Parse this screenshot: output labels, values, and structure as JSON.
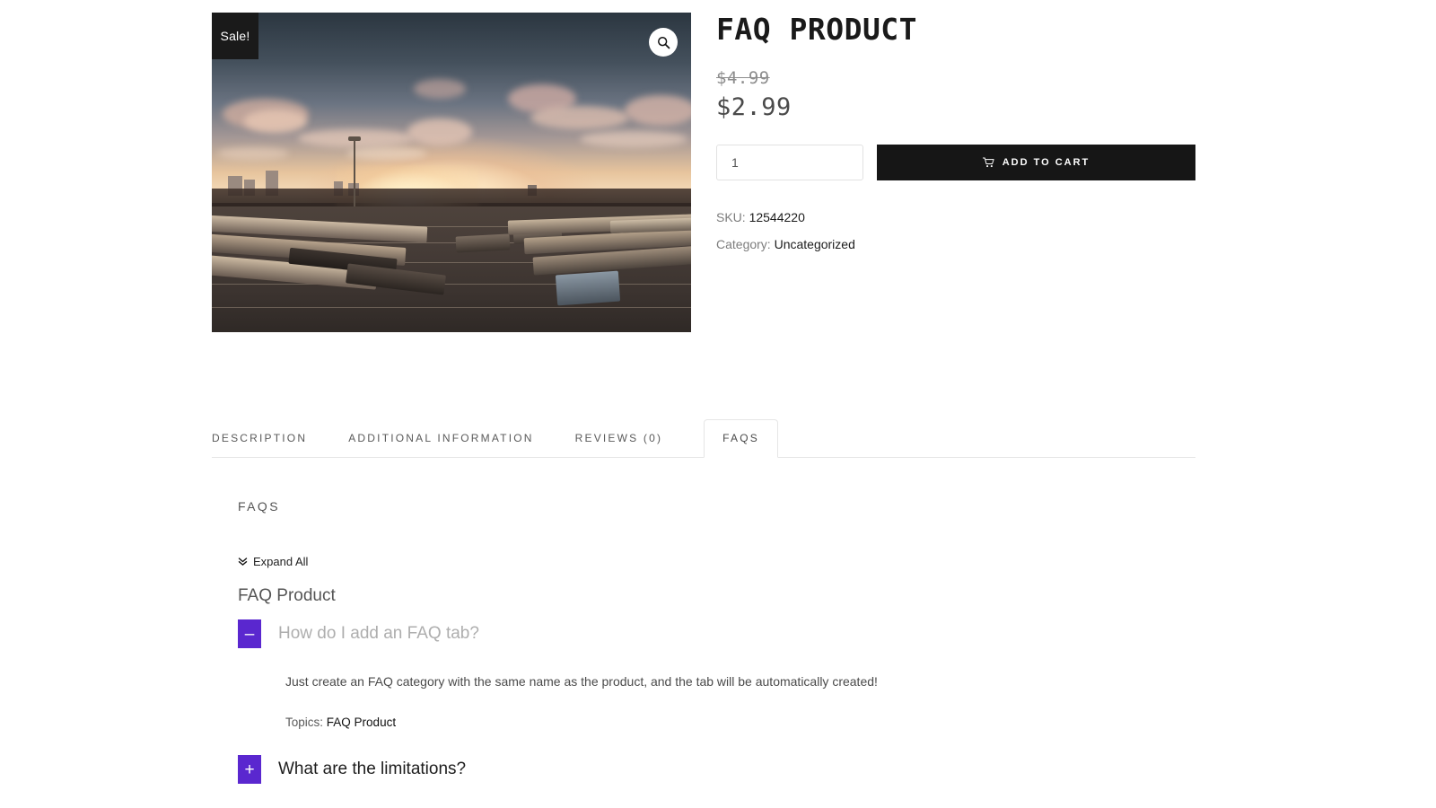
{
  "product": {
    "title": "FAQ PRODUCT",
    "badge": "Sale!",
    "zoom_icon": "search-icon",
    "image_alt": "Railway freight yard at sunset",
    "price_old": "$4.99",
    "price_new": "$2.99",
    "quantity_value": "1",
    "quantity_placeholder": "1",
    "add_to_cart_label": "ADD TO CART",
    "cart_icon": "shopping-cart-icon",
    "sku_label": "SKU:",
    "sku_value": "12544220",
    "category_label": "Category:",
    "category_value": "Uncategorized"
  },
  "tabs": [
    {
      "label": "DESCRIPTION",
      "active": false
    },
    {
      "label": "ADDITIONAL INFORMATION",
      "active": false
    },
    {
      "label": "REVIEWS (0)",
      "active": false
    },
    {
      "label": "FAQS",
      "active": true
    }
  ],
  "panel": {
    "heading": "FAQS",
    "expand_all_label": "Expand All",
    "expand_all_icon": "chevron-double-down-icon",
    "group_title": "FAQ Product",
    "faqs": [
      {
        "question": "How do I add an FAQ tab?",
        "toggle_icon": "minus-icon",
        "toggle_glyph": "–",
        "state": "expanded",
        "answer": "Just create an FAQ category with the same name as the product, and the tab will be automatically created!",
        "topics_label": "Topics:",
        "topics_value": "FAQ Product"
      },
      {
        "question": "What are the limitations?",
        "toggle_icon": "plus-icon",
        "toggle_glyph": "+",
        "state": "collapsed"
      }
    ]
  },
  "colors": {
    "accent_purple": "#5a27cf",
    "badge_black": "#1a1a1a",
    "button_black": "#161616",
    "border_gray": "#e6e6e6",
    "text_dark": "#1d1d1d",
    "text_muted": "#7d7d7d"
  }
}
